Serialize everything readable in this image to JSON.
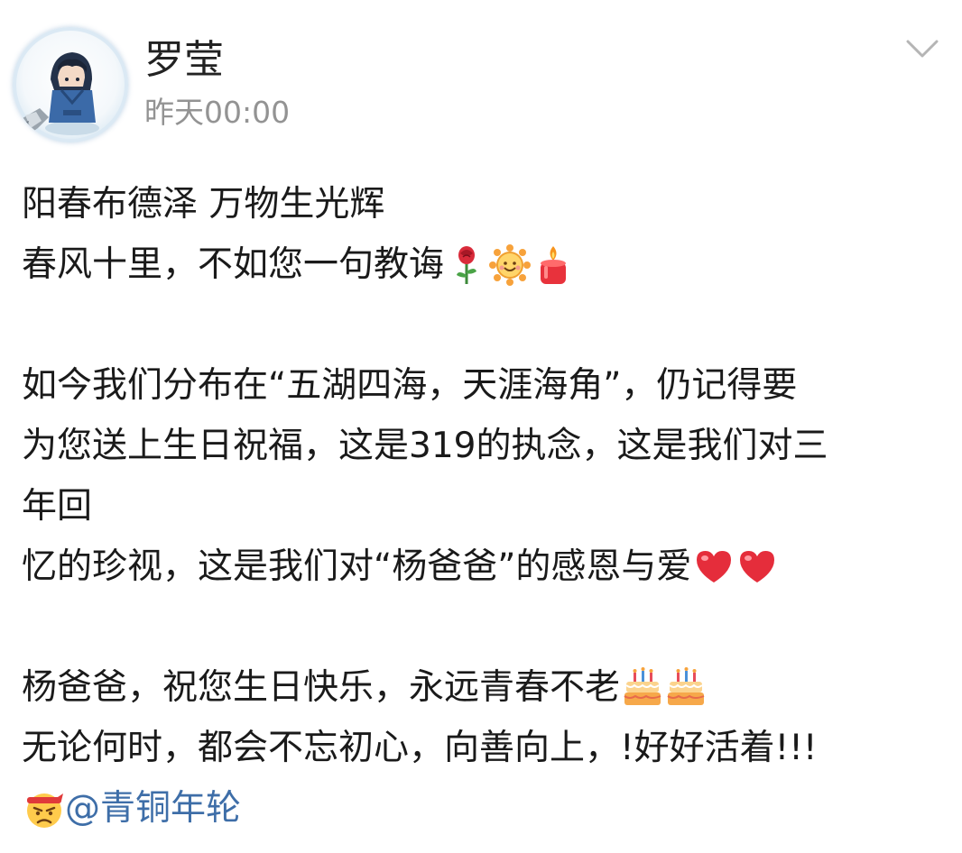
{
  "post": {
    "author": {
      "name": "罗莹",
      "timestamp": "昨天00:00"
    },
    "lines": [
      "阳春布德泽  万物生光辉",
      "春风十里，不如您一句教诲",
      "",
      "如今我们分布在“五湖四海，天涯海角”，仍记得要",
      "为您送上生日祝福，这是319的执念，这是我们对三",
      "年回",
      "忆的珍视，这是我们对“杨爸爸”的感恩与爱",
      "",
      "杨爸爸，祝您生日快乐，永远青春不老",
      "无论何时，都会不忘初心，向善向上，!好好活着!!!"
    ],
    "mention": "@青铜年轮",
    "emojis": {
      "line2": [
        "rose-icon",
        "sun-icon",
        "candle-icon"
      ],
      "line7": [
        "heart-icon",
        "heart-icon"
      ],
      "line9": [
        "cake-icon",
        "cake-icon"
      ],
      "line11": [
        "angry-face-icon"
      ]
    }
  },
  "colors": {
    "mention": "#3e6ea8",
    "timestamp": "#939393",
    "text": "#1a1a1a"
  }
}
